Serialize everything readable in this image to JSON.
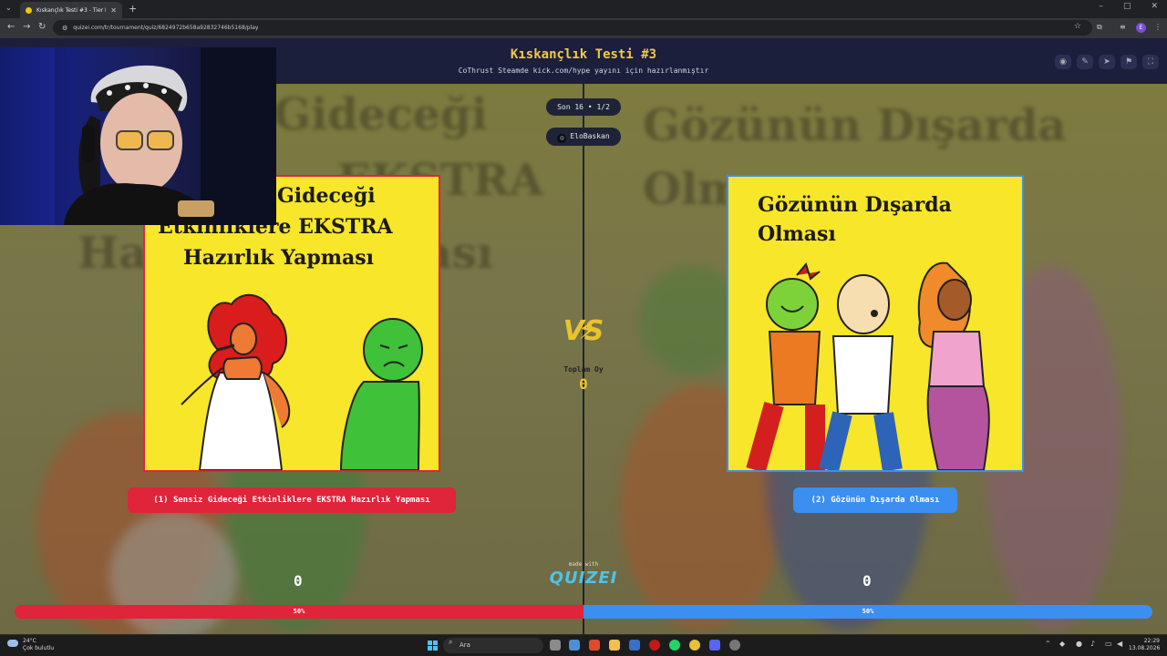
{
  "browser": {
    "tab_title": "Kıskançlık Testi #3 - Tier List, Ki",
    "new_tab": "+",
    "url": "quizei.com/tr/tournament/quiz/6824972b658a92832746b5168/play",
    "profile_initial": "E"
  },
  "header": {
    "title": "Kıskançlık Testi #3",
    "subtitle": "CoThrust Steamde kick.com/hype yayını için hazırlanmıştır"
  },
  "round_pill": "Son 16 • 1/2",
  "creator": "EloBaskan",
  "left": {
    "background_text": [
      "Gideceği",
      "EKSTRA",
      "Hazırlık Yapması"
    ],
    "card_text": [
      "Gideceği",
      "Etkinliklere EKSTRA",
      "Hazırlık Yapması"
    ],
    "button_label": "(1) Sensiz Gideceği Etkinliklere EKSTRA Hazırlık Yapması",
    "votes": "0",
    "percent_label": "50%",
    "percent": 50
  },
  "right": {
    "background_text": [
      "Gözünün Dışarda",
      "Olması"
    ],
    "card_text": [
      "Gözünün Dışarda",
      "Olması"
    ],
    "button_label": "(2) Gözünün Dışarda Olması",
    "votes": "0",
    "percent_label": "50%",
    "percent": 50
  },
  "center": {
    "vs": "VS",
    "total_label": "Toplam Oy",
    "total_value": "0"
  },
  "branding": {
    "made_with": "made with",
    "logo": "QUIZEI"
  },
  "taskbar": {
    "temperature": "24°C",
    "weather": "Çok bulutlu",
    "search_placeholder": "Ara",
    "time": "22:29",
    "date": "13.08.2026"
  },
  "colors": {
    "left_accent": "#e0243a",
    "right_accent": "#3b8ff0",
    "title_yellow": "#f2c94c",
    "card_yellow": "#f7e629"
  }
}
